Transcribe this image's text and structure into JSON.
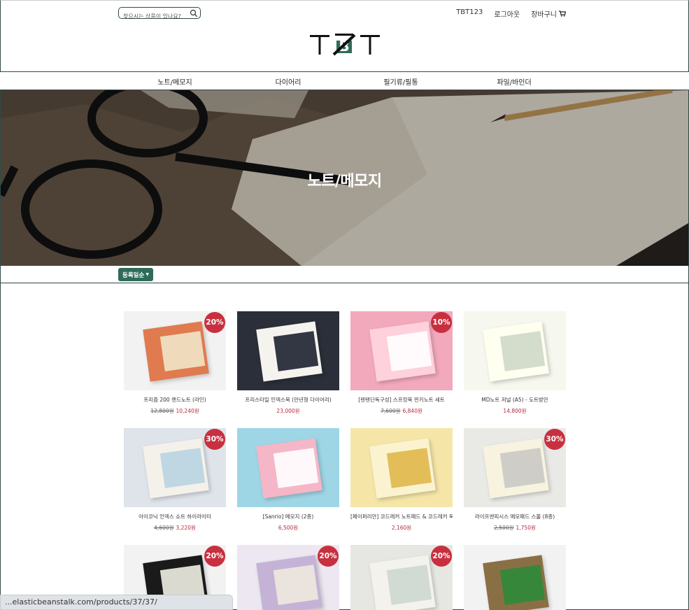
{
  "header": {
    "search_placeholder": "찾으시는 상품이 있나요?",
    "user": "TBT123",
    "logout": "로그아웃",
    "cart": "장바구니",
    "logo_text": "TBT"
  },
  "categories": [
    "노트/메모지",
    "다이어리",
    "필기류/필통",
    "파일/바인더"
  ],
  "hero": {
    "title": "노트/메모지"
  },
  "sort": {
    "label": "등록일순"
  },
  "products": [
    {
      "name": "프리즘 200 멘드노트 (라인)",
      "old_price": "12,800원",
      "price": "10,240원",
      "badge": "20%",
      "colors": [
        "#f2f2f2",
        "#e07a4f",
        "#f1e5c7"
      ]
    },
    {
      "name": "프리스타일 인덱스북 (만년형 다이어리)",
      "old_price": "",
      "price": "23,000원",
      "badge": "",
      "colors": [
        "#2b2f3a",
        "#f5f3ee",
        "#1d2230"
      ]
    },
    {
      "name": "[텐텐단독구성] 스프링북 찐키노트 세트",
      "old_price": "7,600원",
      "price": "6,840원",
      "badge": "10%",
      "colors": [
        "#f2a9bc",
        "#ffd1dc",
        "#ffffff"
      ]
    },
    {
      "name": "MD노트 저널 (A5) - 도트방안",
      "old_price": "",
      "price": "14,800원",
      "badge": "",
      "colors": [
        "#f6f7ee",
        "#fffff0",
        "#cfd8c6"
      ]
    },
    {
      "name": "아이코닉 인덱스 쇼트 하이라이터",
      "old_price": "4,600원",
      "price": "3,220원",
      "badge": "30%",
      "colors": [
        "#dfe3ea",
        "#f4f1ea",
        "#b8d4e2"
      ]
    },
    {
      "name": "[Sanrio] 메모지 (2종)",
      "old_price": "",
      "price": "6,500원",
      "badge": "",
      "colors": [
        "#9fd6e5",
        "#f5b6c8",
        "#ffffff"
      ]
    },
    {
      "name": "[페이퍼리안] 코드레커 노트패드 & 코드레커 북",
      "old_price": "",
      "price": "2,160원",
      "badge": "",
      "colors": [
        "#f5e6a8",
        "#fbf3d0",
        "#e0b84a"
      ]
    },
    {
      "name": "라이프앤피시스 메모패드 스몰 (8종)",
      "old_price": "2,500원",
      "price": "1,750원",
      "badge": "30%",
      "colors": [
        "#e9e9e6",
        "#f7f3df",
        "#c9c9c4"
      ]
    },
    {
      "name": "",
      "old_price": "",
      "price": "",
      "badge": "20%",
      "colors": [
        "#f2f2f2",
        "#1a1a1a",
        "#efefe6"
      ]
    },
    {
      "name": "",
      "old_price": "",
      "price": "",
      "badge": "20%",
      "colors": [
        "#ece7f0",
        "#c4b3d6",
        "#efe9df"
      ]
    },
    {
      "name": "",
      "old_price": "",
      "price": "",
      "badge": "20%",
      "colors": [
        "#e6e7e3",
        "#f3f2ec",
        "#cdd8d1"
      ]
    },
    {
      "name": "",
      "old_price": "",
      "price": "",
      "badge": "",
      "colors": [
        "#f2f2f2",
        "#8a6f45",
        "#2d8a3a"
      ]
    }
  ],
  "status_bar": "...elasticbeanstalk.com/products/37/37/"
}
